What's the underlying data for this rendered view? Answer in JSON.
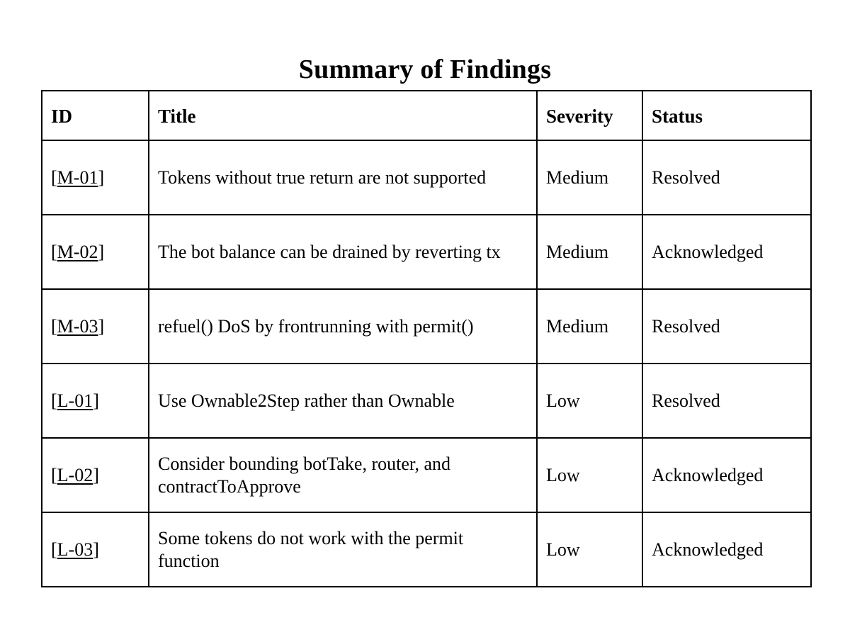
{
  "document": {
    "title": "Summary of Findings"
  },
  "table": {
    "columns": [
      {
        "key": "id",
        "label": "ID"
      },
      {
        "key": "title",
        "label": "Title"
      },
      {
        "key": "severity",
        "label": "Severity"
      },
      {
        "key": "status",
        "label": "Status"
      }
    ],
    "rows": [
      {
        "id_open": "[",
        "id_link": "M-01",
        "id_close": "]",
        "title": "Tokens without true return are not supported",
        "severity": "Medium",
        "status": "Resolved"
      },
      {
        "id_open": "[",
        "id_link": "M-02",
        "id_close": "]",
        "title": "The bot balance can be drained by reverting tx",
        "severity": "Medium",
        "status": "Acknowledged"
      },
      {
        "id_open": "[",
        "id_link": "M-03",
        "id_close": "]",
        "title": "refuel() DoS by frontrunning with permit()",
        "severity": "Medium",
        "status": "Resolved"
      },
      {
        "id_open": "[",
        "id_link": "L-01",
        "id_close": "]",
        "title": "Use Ownable2Step rather than Ownable",
        "severity": "Low",
        "status": "Resolved"
      },
      {
        "id_open": "[",
        "id_link": "L-02",
        "id_close": "]",
        "title": "Consider bounding botTake, router, and contractToApprove",
        "severity": "Low",
        "status": "Acknowledged"
      },
      {
        "id_open": "[",
        "id_link": "L-03",
        "id_close": "]",
        "title": "Some tokens do not work with the permit function",
        "severity": "Low",
        "status": "Acknowledged"
      }
    ]
  }
}
